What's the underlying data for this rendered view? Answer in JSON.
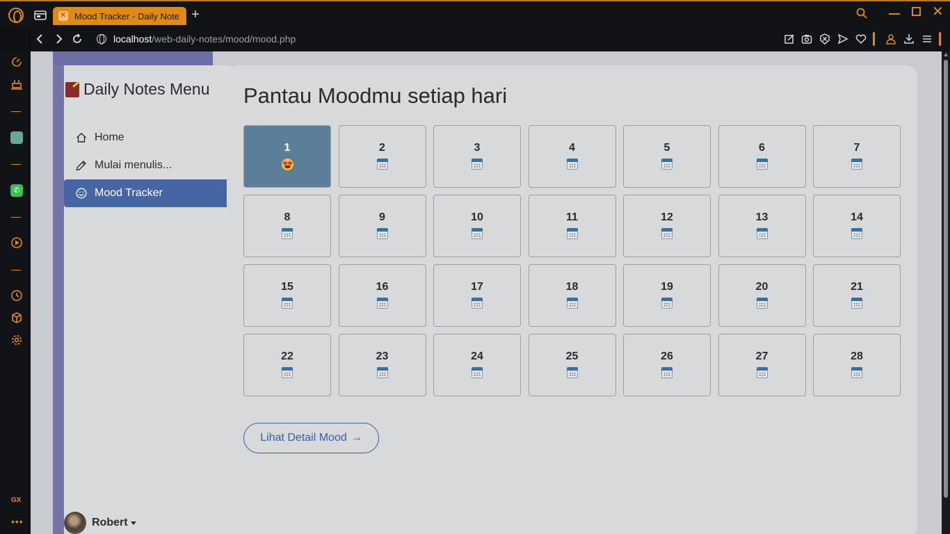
{
  "browser": {
    "tab_title": "Mood Tracker - Daily Notes",
    "url_host": "localhost",
    "url_path": "/web-daily-notes/mood/mood.php",
    "accent_color": "#e08a16"
  },
  "sidebar": {
    "brand": "Daily Notes Menu",
    "items": [
      {
        "label": "Home",
        "icon": "home-icon"
      },
      {
        "label": "Mulai menulis...",
        "icon": "pencil-icon"
      },
      {
        "label": "Mood Tracker",
        "icon": "smile-icon",
        "active": true
      }
    ],
    "user": "Robert"
  },
  "main": {
    "title": "Pantau Moodmu setiap hari",
    "days": [
      {
        "day": "1",
        "mood": "heart-eyes-emoji",
        "selected": true
      },
      {
        "day": "2"
      },
      {
        "day": "3"
      },
      {
        "day": "4"
      },
      {
        "day": "5"
      },
      {
        "day": "6"
      },
      {
        "day": "7"
      },
      {
        "day": "8"
      },
      {
        "day": "9"
      },
      {
        "day": "10"
      },
      {
        "day": "11"
      },
      {
        "day": "12"
      },
      {
        "day": "13"
      },
      {
        "day": "14"
      },
      {
        "day": "15"
      },
      {
        "day": "16"
      },
      {
        "day": "17"
      },
      {
        "day": "18"
      },
      {
        "day": "19"
      },
      {
        "day": "20"
      },
      {
        "day": "21"
      },
      {
        "day": "22"
      },
      {
        "day": "23"
      },
      {
        "day": "24"
      },
      {
        "day": "25"
      },
      {
        "day": "26"
      },
      {
        "day": "27"
      },
      {
        "day": "28"
      }
    ],
    "detail_button": "Lihat Detail Mood",
    "detail_arrow": "→",
    "selected_color": "#5b7e99",
    "primary_color": "#4665a3"
  }
}
